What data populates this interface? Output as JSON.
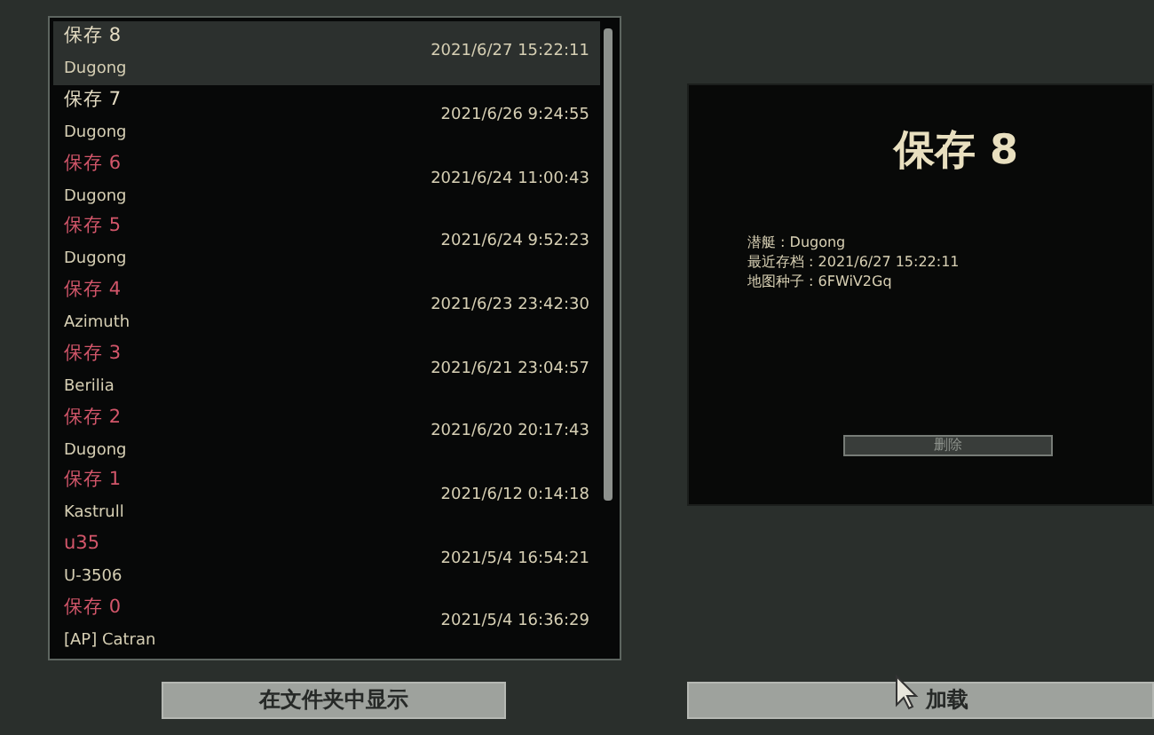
{
  "saves": [
    {
      "title": "保存 8",
      "submarine": "Dugong",
      "date": "2021/6/27 15:22:11",
      "compatible": true,
      "selected": true
    },
    {
      "title": "保存 7",
      "submarine": "Dugong",
      "date": "2021/6/26 9:24:55",
      "compatible": true,
      "selected": false
    },
    {
      "title": "保存 6",
      "submarine": "Dugong",
      "date": "2021/6/24 11:00:43",
      "compatible": false,
      "selected": false
    },
    {
      "title": "保存 5",
      "submarine": "Dugong",
      "date": "2021/6/24 9:52:23",
      "compatible": false,
      "selected": false
    },
    {
      "title": "保存 4",
      "submarine": "Azimuth",
      "date": "2021/6/23 23:42:30",
      "compatible": false,
      "selected": false
    },
    {
      "title": "保存 3",
      "submarine": "Berilia",
      "date": "2021/6/21 23:04:57",
      "compatible": false,
      "selected": false
    },
    {
      "title": "保存 2",
      "submarine": "Dugong",
      "date": "2021/6/20 20:17:43",
      "compatible": false,
      "selected": false
    },
    {
      "title": "保存 1",
      "submarine": "Kastrull",
      "date": "2021/6/12 0:14:18",
      "compatible": false,
      "selected": false
    },
    {
      "title": "u35",
      "submarine": "U-3506",
      "date": "2021/5/4 16:54:21",
      "compatible": false,
      "selected": false
    },
    {
      "title": "保存 0",
      "submarine": "[AP] Catran",
      "date": "2021/5/4 16:36:29",
      "compatible": false,
      "selected": false
    }
  ],
  "detail": {
    "title": "保存 8",
    "lines": [
      "潜艇 : Dugong",
      "最近存档 : 2021/6/27 15:22:11",
      "地图种子 : 6FWiV2Gq"
    ],
    "delete_button": "删除"
  },
  "show_in_folder_button": "在文件夹中显示",
  "load_button": "加载"
}
